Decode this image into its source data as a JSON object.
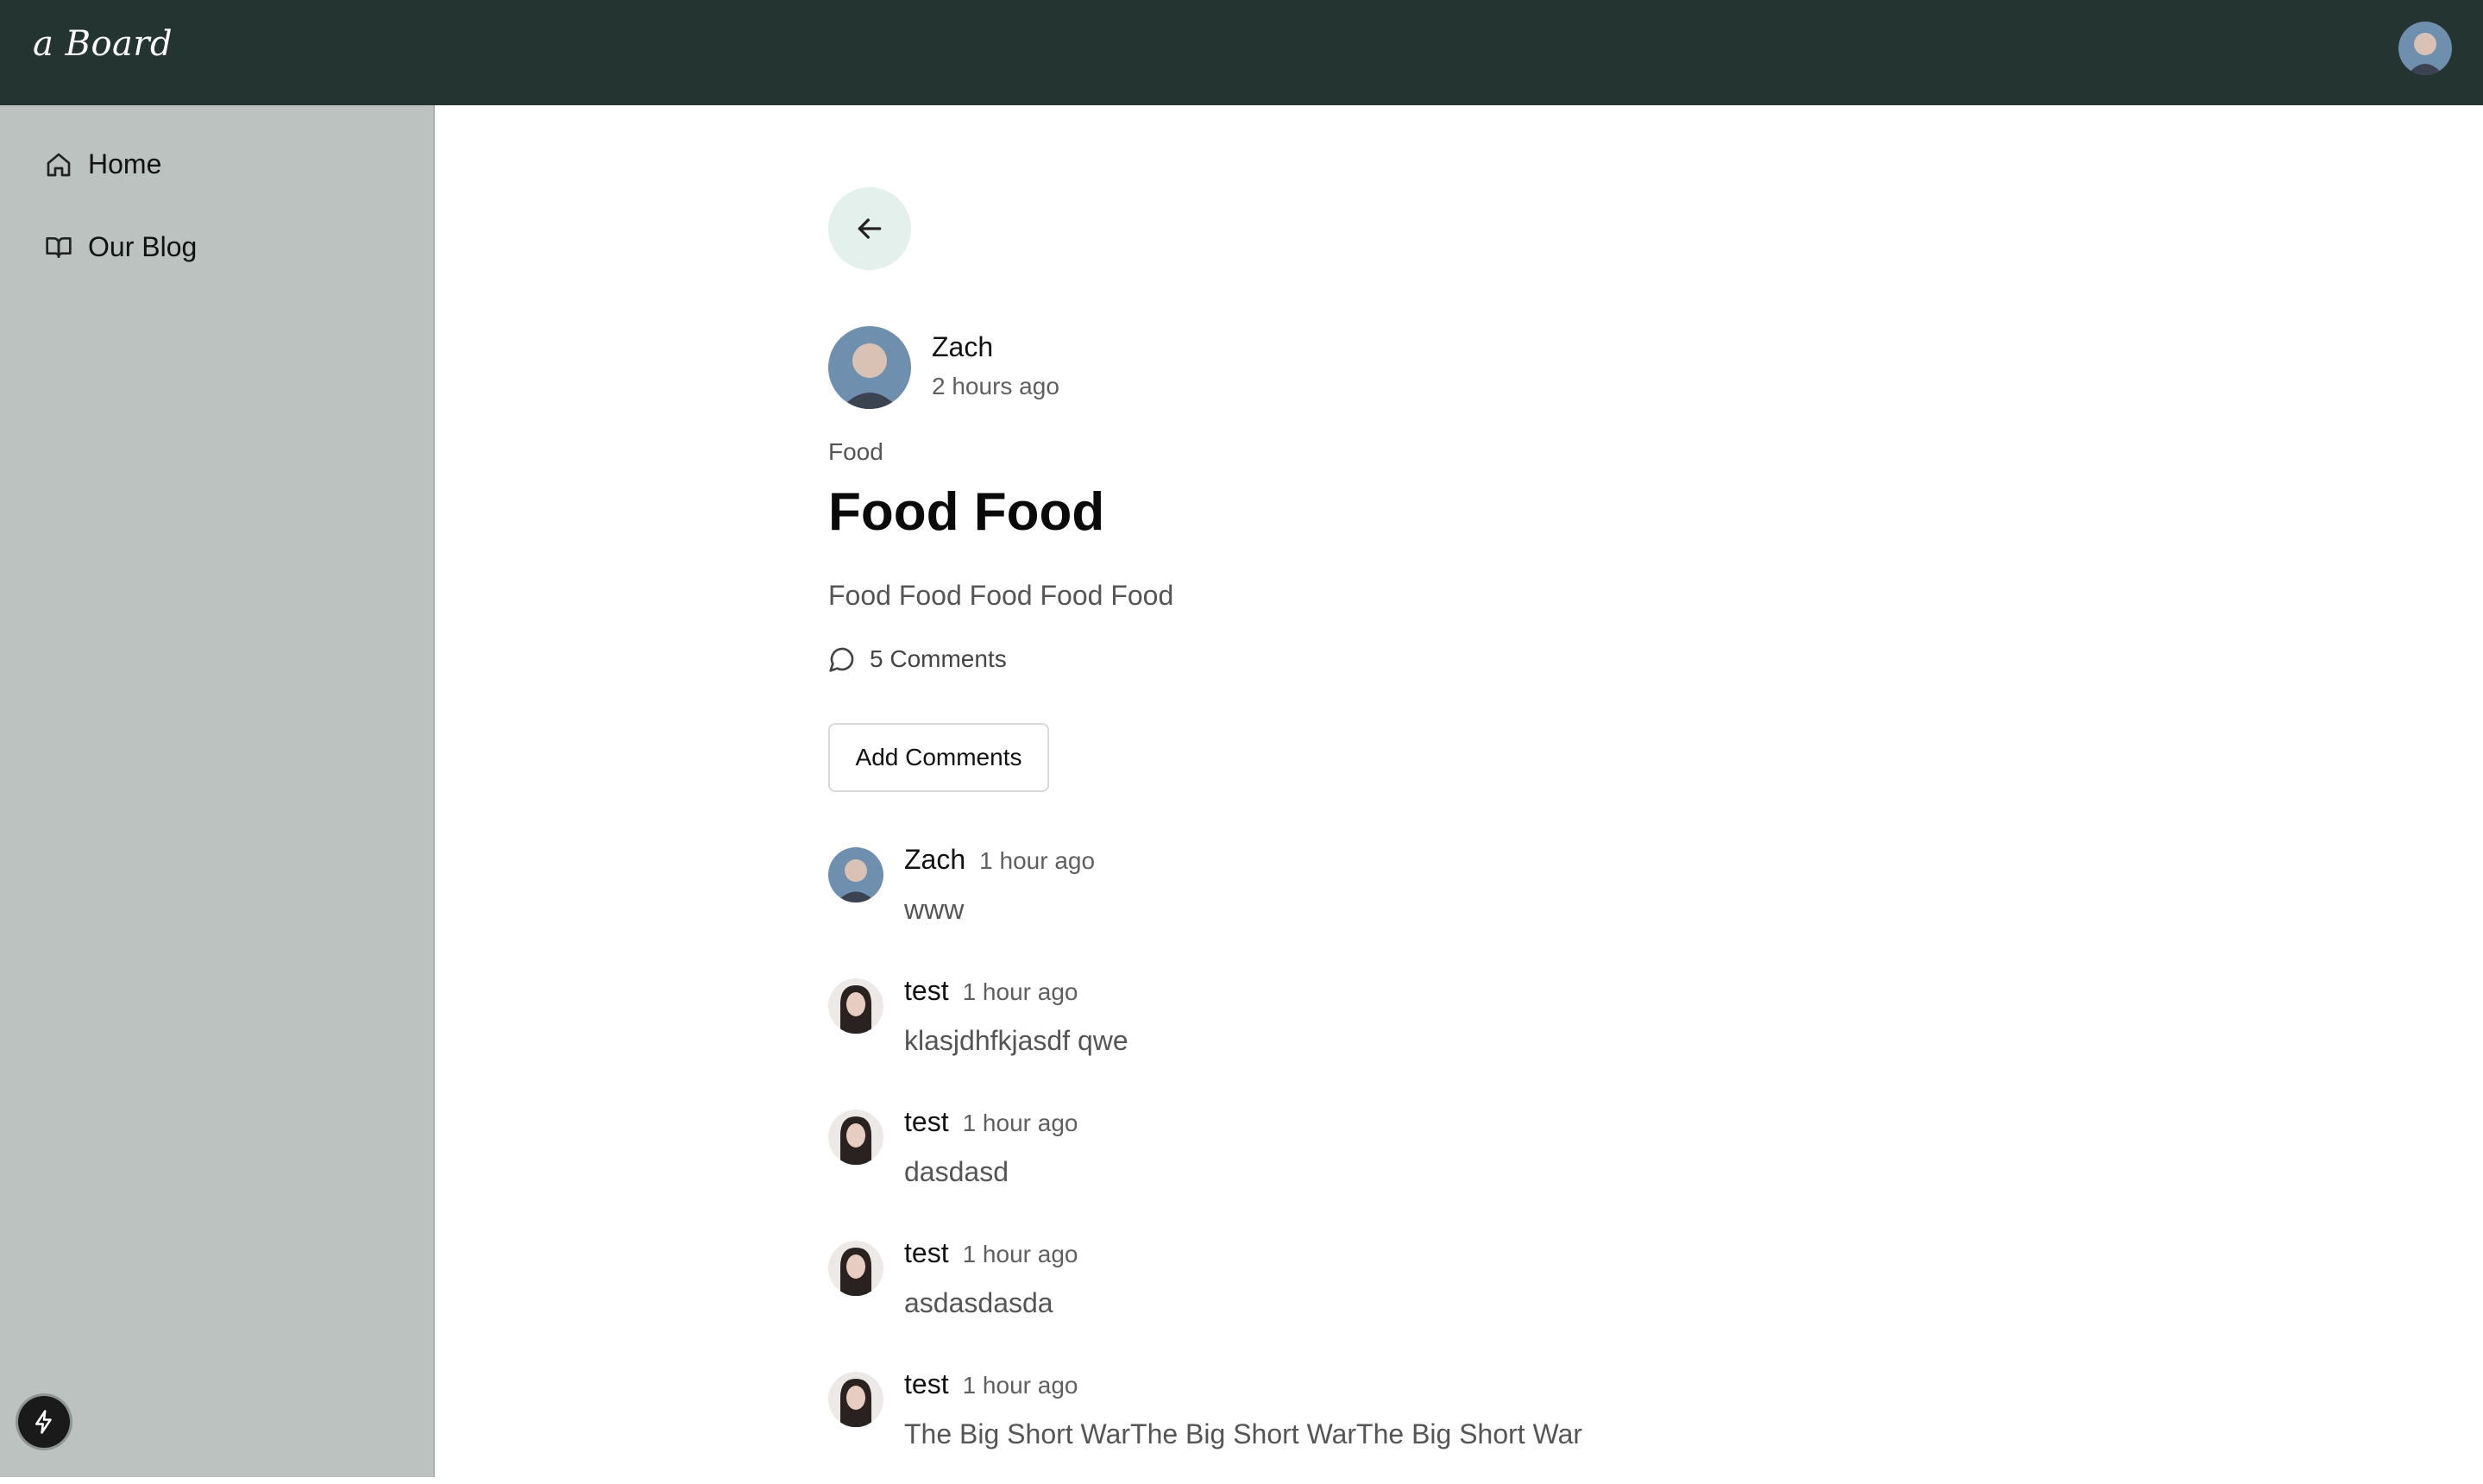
{
  "header": {
    "brand": "a Board",
    "avatar_icon": "user-avatar-male"
  },
  "sidebar": {
    "items": [
      {
        "label": "Home",
        "icon": "home-icon"
      },
      {
        "label": "Our Blog",
        "icon": "book-icon"
      }
    ],
    "bottom_icon": "bolt-icon"
  },
  "post": {
    "author": "Zach",
    "time": "2 hours ago",
    "category": "Food",
    "title": "Food Food",
    "body": "Food Food Food Food Food",
    "comments_count": "5 Comments",
    "add_comments_label": "Add Comments"
  },
  "comments": [
    {
      "name": "Zach",
      "time": "1 hour ago",
      "text": "www",
      "avatar": "male"
    },
    {
      "name": "test",
      "time": "1 hour ago",
      "text": "klasjdhfkjasdf qwe",
      "avatar": "female"
    },
    {
      "name": "test",
      "time": "1 hour ago",
      "text": "dasdasd",
      "avatar": "female"
    },
    {
      "name": "test",
      "time": "1 hour ago",
      "text": "asdasdasda",
      "avatar": "female"
    },
    {
      "name": "test",
      "time": "1 hour ago",
      "text": "The Big Short WarThe Big Short WarThe Big Short War",
      "avatar": "female"
    }
  ],
  "colors": {
    "topbar": "#243431",
    "sidebar": "#bbc2bf",
    "back_button_bg": "#e3f0ec"
  }
}
